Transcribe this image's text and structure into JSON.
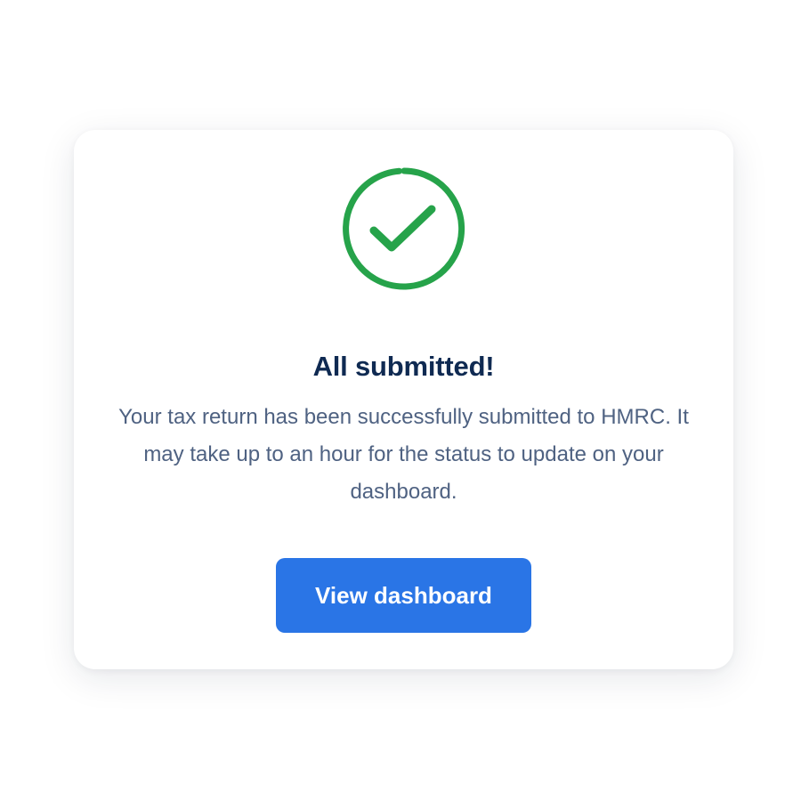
{
  "success_card": {
    "icon": "check-circle-icon",
    "icon_color": "#26a34a",
    "title": "All submitted!",
    "message": "Your tax return has been successfully submitted to HMRC. It may take up to an hour for the status to update on your dashboard.",
    "button_label": "View dashboard",
    "button_color": "#2a75e6"
  }
}
